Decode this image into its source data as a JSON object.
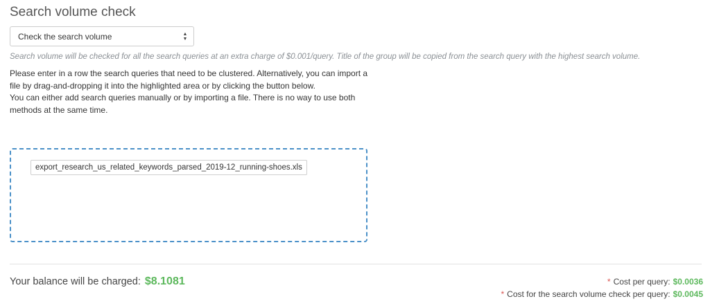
{
  "section": {
    "title": "Search volume check"
  },
  "volume_select": {
    "selected": "Check the search volume"
  },
  "note": "Search volume will be checked for all the search queries at an extra charge of $0.001/query. Title of the group will be copied from the search query with the highest search volume.",
  "instructions": {
    "line1": "Please enter in a row the search queries that need to be clustered. Alternatively, you can import a file by drag-and-dropping it into the highlighted area or by clicking the button below.",
    "line2": "You can either add search queries manually or by importing a file. There is no way to use both methods at the same time."
  },
  "dropzone": {
    "file_name": "export_research_us_related_keywords_parsed_2019-12_running-shoes.xls"
  },
  "summary": {
    "balance_label": "Your balance will be charged:",
    "balance_amount": "$8.1081",
    "cost_per_query_label": "Cost per query:",
    "cost_per_query_value": "$0.0036",
    "volume_check_label": "Cost for the search volume check per query:",
    "volume_check_value": "$0.0045",
    "asterisk": "*"
  },
  "colors": {
    "accent_green": "#5cb85c",
    "dropzone_border": "#4a90c8",
    "asterisk_red": "#d9534f"
  }
}
